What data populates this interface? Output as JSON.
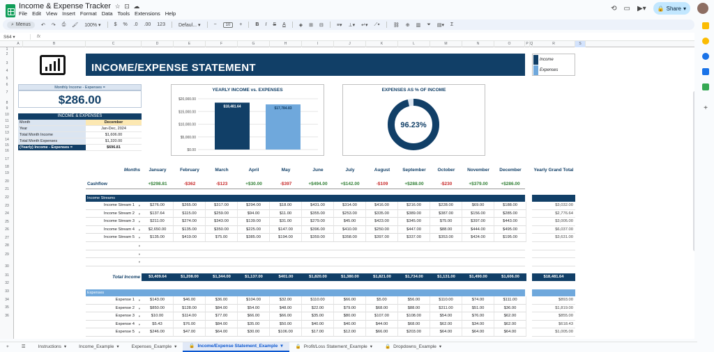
{
  "app": {
    "title": "Income & Expense Tracker",
    "menus": [
      "File",
      "Edit",
      "View",
      "Insert",
      "Format",
      "Data",
      "Tools",
      "Extensions",
      "Help"
    ],
    "share_label": "Share"
  },
  "toolbar": {
    "search_label": "Menus",
    "zoom": "100%",
    "currency": "$",
    "percent": "%",
    "dec_less": ".0",
    "dec_more": ".00",
    "num_format": "123",
    "font": "Defaul...",
    "font_size": "10"
  },
  "formula_bar": {
    "cell_ref": "S64",
    "fx": "fx"
  },
  "columns": [
    "A",
    "B",
    "C",
    "D",
    "E",
    "F",
    "G",
    "H",
    "I",
    "J",
    "K",
    "L",
    "M",
    "N",
    "O",
    "P",
    "Q",
    "R",
    "S"
  ],
  "rows": [
    "1",
    "2",
    "3",
    "4",
    "5",
    "6",
    "7",
    "8",
    "9",
    "10",
    "11",
    "12",
    "13",
    "14",
    "15",
    "16",
    "17",
    "18",
    "19",
    "20",
    "21",
    "22",
    "23",
    "24",
    "25",
    "26",
    "27",
    "28",
    "29",
    "30",
    "31",
    "32",
    "33",
    "34",
    "35",
    "36"
  ],
  "banner": {
    "title": "INCOME/EXPENSE STATEMENT"
  },
  "legend": {
    "income": "Income",
    "expenses": "Expenses",
    "income_color": "#113f67",
    "expense_color": "#6fa8dc"
  },
  "summary": {
    "label": "Monthly Income - Expenses =",
    "value": "$286.00"
  },
  "ie_table": {
    "header": "INCOME & EXPENSES",
    "rows": [
      {
        "k": "Month",
        "v": "December"
      },
      {
        "k": "Year",
        "v": "Jan-Dec, 2024"
      },
      {
        "k": "Total Month Income",
        "v": "$1,606.00"
      },
      {
        "k": "Total Month Expenses",
        "v": "$1,320.00"
      },
      {
        "k": "(Yearly) Income  - Expenses =",
        "v": "$696.81"
      }
    ]
  },
  "chart_data": [
    {
      "type": "bar",
      "title": "YEARLY INCOME vs. EXPENSES",
      "categories": [
        "Income",
        "Expenses"
      ],
      "values": [
        18481.64,
        17784.83
      ],
      "data_labels": [
        "$18,481.64",
        "$17,784.83"
      ],
      "y_ticks": [
        "$20,000.00",
        "$15,000.00",
        "$10,000.00",
        "$5,000.00",
        "$0.00"
      ],
      "ylim": [
        0,
        20000
      ],
      "colors": [
        "#113f67",
        "#6fa8dc"
      ]
    },
    {
      "type": "pie",
      "title": "EXPENSES AS % OF INCOME",
      "values": [
        96.23
      ],
      "center_label": "96.23%",
      "color": "#113f67"
    }
  ],
  "months_label": "Months",
  "months": [
    "January",
    "February",
    "March",
    "April",
    "May",
    "June",
    "July",
    "August",
    "September",
    "October",
    "November",
    "December"
  ],
  "grand_label": "Yearly Grand Total",
  "cashflow": {
    "label": "Cashflow",
    "values": [
      "+$298.81",
      "-$362",
      "-$123",
      "+$30.00",
      "-$397",
      "+$494.00",
      "+$142.00",
      "-$109",
      "+$288.00",
      "-$230",
      "+$379.00",
      "+$286.00"
    ],
    "pos_color": "#2e7d32",
    "neg_color": "#c62828"
  },
  "income": {
    "section": "Income Streams",
    "section_color": "#113f67",
    "rows": [
      {
        "label": "Income Stream 1",
        "values": [
          "$276.00",
          "$265.00",
          "$317.00",
          "$294.00",
          "$18.00",
          "$431.00",
          "$314.00",
          "$416.00",
          "$216.00",
          "$228.00",
          "$69.00",
          "$188.00"
        ],
        "total": "$3,032.00"
      },
      {
        "label": "Income Stream 2",
        "values": [
          "$137.64",
          "$115.00",
          "$259.00",
          "$94.00",
          "$11.00",
          "$355.00",
          "$253.00",
          "$335.00",
          "$389.00",
          "$387.00",
          "$156.00",
          "$285.00"
        ],
        "total": "$2,776.64"
      },
      {
        "label": "Income Stream 3",
        "values": [
          "$211.00",
          "$274.00",
          "$343.00",
          "$139.00",
          "$31.00",
          "$279.00",
          "$45.00",
          "$423.00",
          "$345.00",
          "$75.00",
          "$397.00",
          "$443.00"
        ],
        "total": "$3,005.00"
      },
      {
        "label": "Income Stream 4",
        "values": [
          "$2,650.00",
          "$135.00",
          "$350.00",
          "$225.00",
          "$147.00",
          "$396.00",
          "$410.00",
          "$250.00",
          "$447.00",
          "$88.00",
          "$444.00",
          "$495.00"
        ],
        "total": "$6,037.00"
      },
      {
        "label": "Income Stream 5",
        "values": [
          "$135.00",
          "$419.00",
          "$75.00",
          "$385.00",
          "$194.00",
          "$359.00",
          "$358.00",
          "$397.00",
          "$337.00",
          "$353.00",
          "$424.00",
          "$195.00"
        ],
        "total": "$3,631.00"
      }
    ],
    "total_label": "Total Income",
    "totals": [
      "$3,409.64",
      "$1,208.00",
      "$1,344.00",
      "$1,137.00",
      "$401.00",
      "$1,820.00",
      "$1,380.00",
      "$1,821.00",
      "$1,734.00",
      "$1,131.00",
      "$1,490.00",
      "$1,606.00"
    ],
    "grand_total": "$18,481.64"
  },
  "expenses": {
    "section": "Expenses",
    "section_color": "#6fa8dc",
    "rows": [
      {
        "label": "Expense 1",
        "values": [
          "$143.00",
          "$46.00",
          "$36.00",
          "$104.00",
          "$32.00",
          "$110.00",
          "$66.00",
          "$5.00",
          "$56.00",
          "$110.00",
          "$74.00",
          "$111.00"
        ],
        "total": "$893.00"
      },
      {
        "label": "Expense 2",
        "values": [
          "$850.00",
          "$128.00",
          "$84.00",
          "$54.00",
          "$48.00",
          "$22.00",
          "$79.00",
          "$68.00",
          "$88.00",
          "$311.00",
          "$51.00",
          "$36.00"
        ],
        "total": "$1,819.00"
      },
      {
        "label": "Expense 3",
        "values": [
          "$10.00",
          "$114.00",
          "$77.00",
          "$66.00",
          "$66.00",
          "$35.00",
          "$80.00",
          "$107.00",
          "$108.00",
          "$54.00",
          "$76.00",
          "$62.00"
        ],
        "total": "$855.00"
      },
      {
        "label": "Expense 4",
        "values": [
          "$5.43",
          "$76.00",
          "$84.00",
          "$35.00",
          "$50.00",
          "$40.00",
          "$40.00",
          "$44.00",
          "$68.00",
          "$62.00",
          "$34.00",
          "$62.00"
        ],
        "total": "$618.43"
      },
      {
        "label": "Expense 5",
        "values": [
          "$246.00",
          "$47.00",
          "$64.00",
          "$30.00",
          "$106.00",
          "$17.00",
          "$12.00",
          "$66.00",
          "$203.00",
          "$64.00",
          "$64.00",
          "$64.00"
        ],
        "total": "$1,005.00"
      }
    ]
  },
  "tabs": [
    "Instructions",
    "Income_Example",
    "Expenses_Example",
    "Income/Expense Statement_Example",
    "Profit/Loss Statement_Example",
    "Dropdowns_Example"
  ],
  "active_tab": 3
}
